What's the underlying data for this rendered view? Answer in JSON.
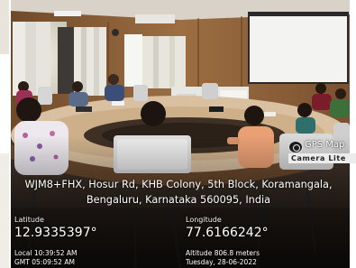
{
  "overlay": {
    "brand_line1": "GPS Map",
    "brand_line2": "Camera Lite",
    "address_line1": "WJM8+FHX, Hosur Rd, KHB Colony, 5th Block, Koramangala,",
    "address_line2": "Bengaluru, Karnataka 560095, India",
    "latitude_label": "Latitude",
    "latitude_value": "12.9335397°",
    "longitude_label": "Longitude",
    "longitude_value": "77.6166242°",
    "local_time": "Local 10:39:52 AM",
    "gmt_time": "GMT 05:09:52 AM",
    "altitude": "Altitude 806.8 meters",
    "date": "Tuesday, 28-06-2022"
  },
  "colors": {
    "wall": "#9a6a3c",
    "table": "#c9a57a",
    "overlay_text": "#ffffff"
  }
}
